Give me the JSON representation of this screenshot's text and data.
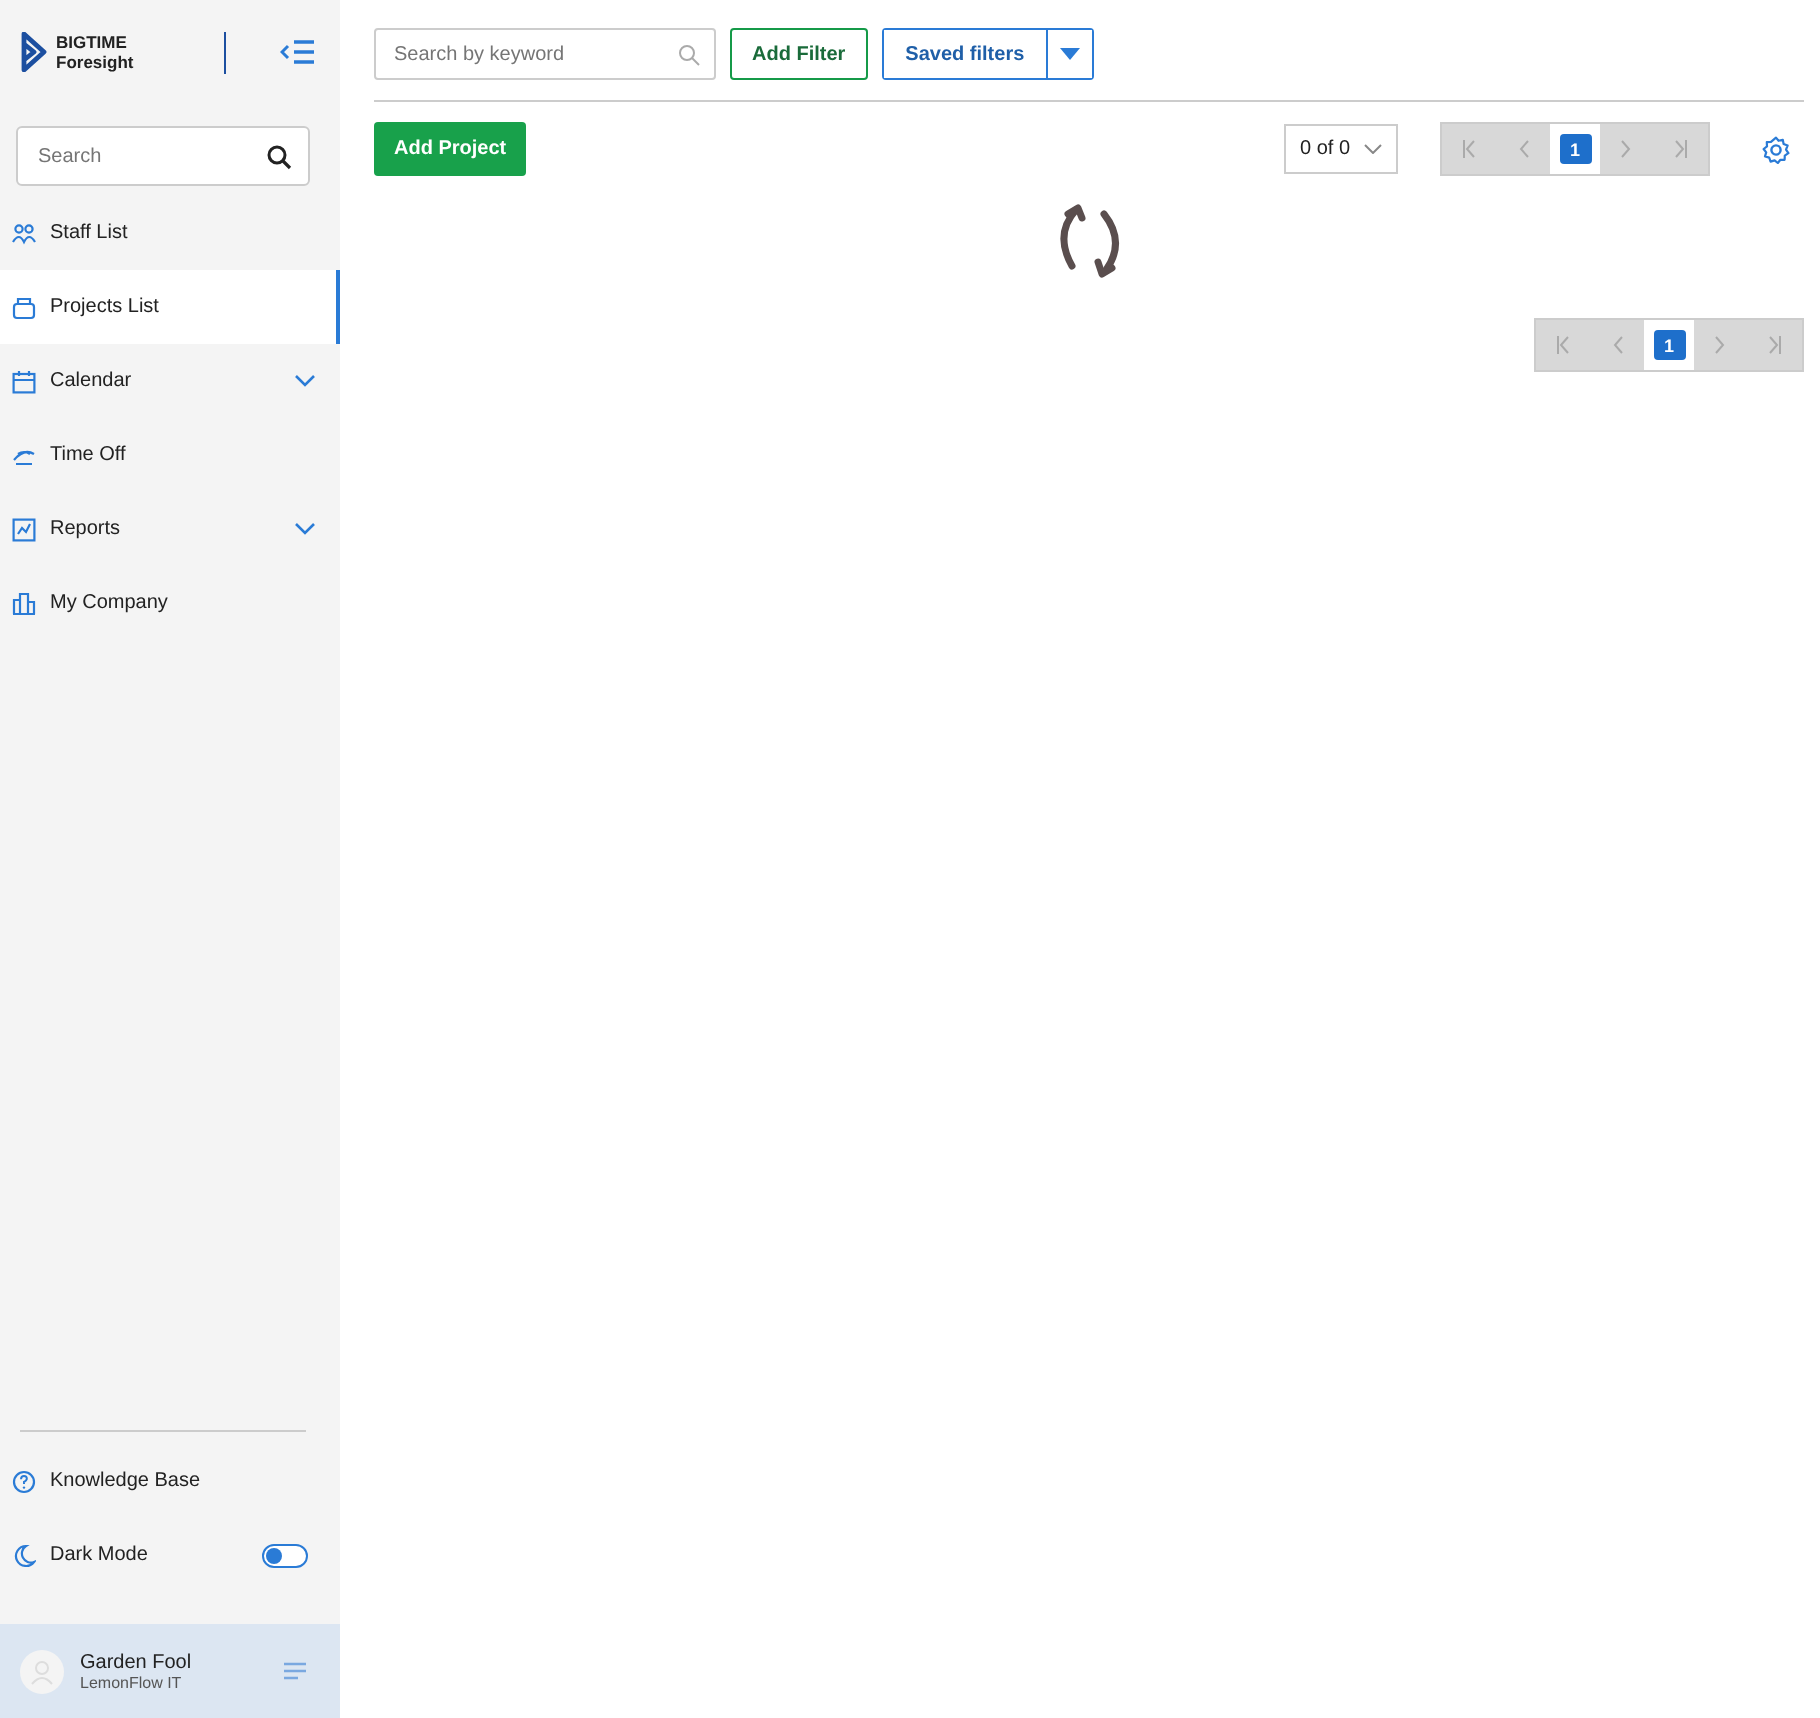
{
  "brand": {
    "line1": "BIGTIME",
    "line2": "Foresight"
  },
  "sidebar": {
    "search": {
      "placeholder": "Search"
    },
    "items": [
      {
        "label": "Staff List",
        "selected": false,
        "expandable": false
      },
      {
        "label": "Projects List",
        "selected": true,
        "expandable": false
      },
      {
        "label": "Calendar",
        "selected": false,
        "expandable": true
      },
      {
        "label": "Time Off",
        "selected": false,
        "expandable": false
      },
      {
        "label": "Reports",
        "selected": false,
        "expandable": true
      },
      {
        "label": "My Company",
        "selected": false,
        "expandable": false
      }
    ],
    "bottom": [
      {
        "label": "Knowledge Base",
        "kind": "link"
      },
      {
        "label": "Dark Mode",
        "kind": "toggle",
        "on": false
      }
    ],
    "user": {
      "name": "Garden Fool",
      "company": "LemonFlow IT"
    }
  },
  "toolbar": {
    "search": {
      "placeholder": "Search by keyword"
    },
    "add_filter": "Add Filter",
    "saved_filters": "Saved filters"
  },
  "add_project": "Add Project",
  "count_select": "0 of 0",
  "top_pager": {
    "pages": [
      {
        "label": "1",
        "selected": true
      }
    ]
  },
  "bottom_pager": {
    "pages": [
      {
        "label": "1",
        "selected": true
      }
    ]
  }
}
